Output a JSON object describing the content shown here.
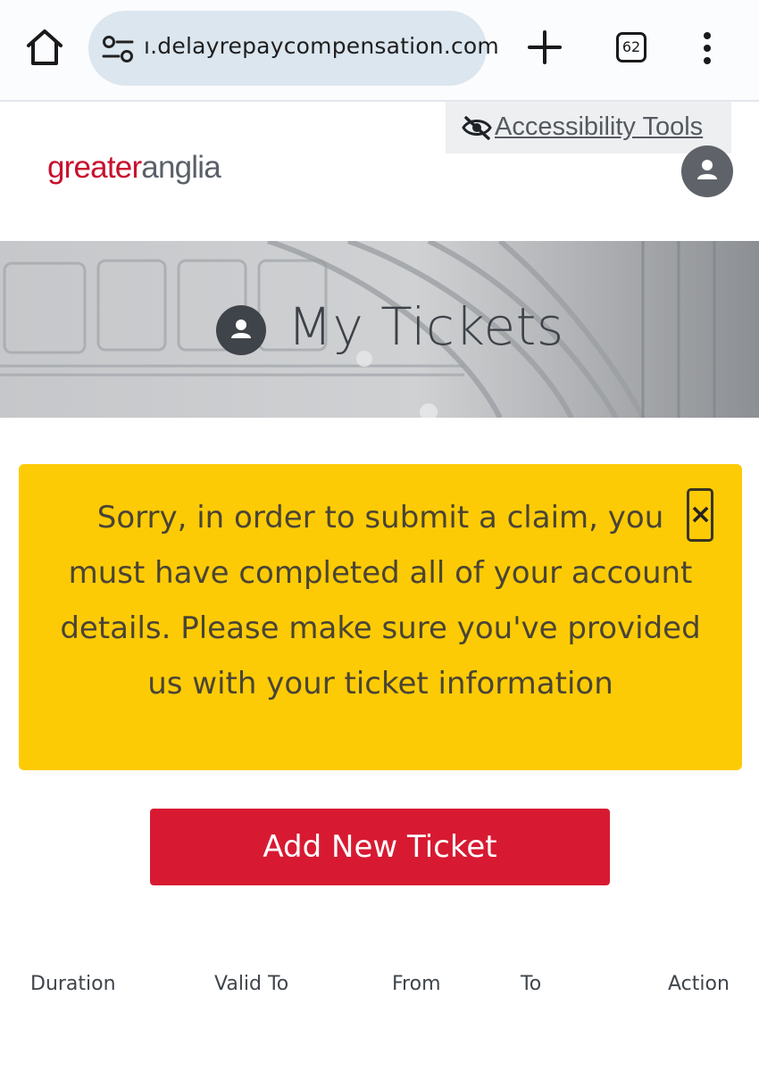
{
  "browser": {
    "url": "ı.delayrepaycompensation.com",
    "tab_count": "62"
  },
  "site": {
    "accessibility_tools": "Accessibility Tools",
    "logo_part1": "greater",
    "logo_part2": "anglia"
  },
  "hero": {
    "title": "My Tickets"
  },
  "alert": {
    "message": "Sorry, in order to submit a claim, you must have completed all of your account details. Please make sure you've provided us with your ticket information",
    "close_symbol": "×"
  },
  "actions": {
    "add_ticket": "Add New Ticket"
  },
  "table": {
    "columns": [
      "Duration",
      "Valid To",
      "From",
      "To",
      "Action"
    ]
  },
  "colors": {
    "brand_red": "#d71a32",
    "alert_yellow": "#fdcb05",
    "logo_grey": "#5a6068"
  }
}
